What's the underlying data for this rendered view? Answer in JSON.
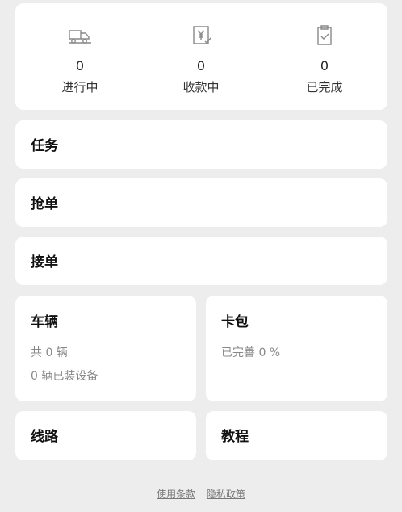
{
  "stats": [
    {
      "icon": "truck-icon",
      "value": "0",
      "label": "进行中"
    },
    {
      "icon": "yen-receipt-icon",
      "value": "0",
      "label": "收款中"
    },
    {
      "icon": "clipboard-check-icon",
      "value": "0",
      "label": "已完成"
    }
  ],
  "menu": {
    "task": "任务",
    "grab": "抢单",
    "accept": "接单"
  },
  "vehicle": {
    "title": "车辆",
    "count": "共 0 辆",
    "devices": "0 辆已装设备"
  },
  "cardpack": {
    "title": "卡包",
    "progress": "已完善 0 %"
  },
  "route": {
    "title": "线路"
  },
  "tutorial": {
    "title": "教程"
  },
  "footer": {
    "terms": "使用条款",
    "privacy": "隐私政策"
  },
  "colors": {
    "background": "#ededed",
    "card": "#ffffff",
    "icon_stroke": "#888888"
  }
}
